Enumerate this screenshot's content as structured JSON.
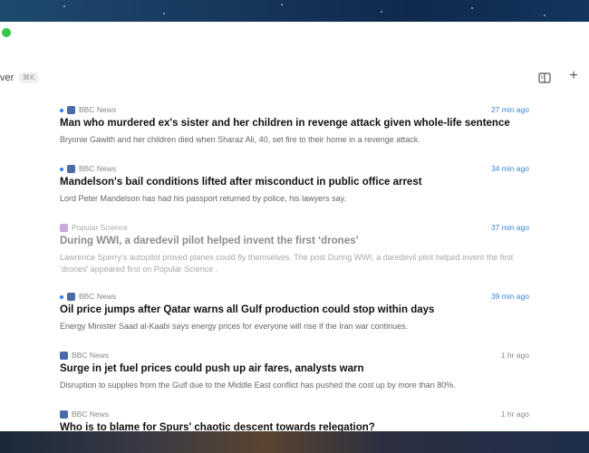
{
  "toolbar": {
    "search_label": "ver",
    "shortcut": "⌘K",
    "columns_icon": "columns-icon",
    "add_label": "+"
  },
  "articles": [
    {
      "source": "BBC News",
      "time": "27 min ago",
      "headline": "Man who murdered ex's sister and her children in revenge attack given whole-life sentence",
      "summary": "Bryonie Gawith and her children died when Sharaz Ali, 40, set fire to their home in a revenge attack.",
      "unread": true
    },
    {
      "source": "BBC News",
      "time": "34 min ago",
      "headline": "Mandelson's bail conditions lifted after misconduct in public office arrest",
      "summary": "Lord Peter Mandelson has had his passport returned by police, his lawyers say.",
      "unread": true
    },
    {
      "source": "Popular Science",
      "time": "37 min ago",
      "headline": "During WWI, a daredevil pilot helped invent the first ‘drones’",
      "summary": "Lawrence Sperry's autopilot proved planes could fly themselves. The post During WWI, a daredevil pilot helped invent the first ‘drones’ appeared first on Popular Science .",
      "unread": false
    },
    {
      "source": "BBC News",
      "time": "39 min ago",
      "headline": "Oil price jumps after Qatar warns all Gulf production could stop within days",
      "summary": "Energy Minister Saad al-Kaabi says energy prices for everyone will rise if the Iran war continues.",
      "unread": true
    },
    {
      "source": "BBC News",
      "time": "1 hr ago",
      "headline": "Surge in jet fuel prices could push up air fares, analysts warn",
      "summary": "Disruption to supplies from the Gulf due to the Middle East conflict has pushed the cost up by more than 80%.",
      "unread": false
    },
    {
      "source": "BBC News",
      "time": "1 hr ago",
      "headline": "Who is to blame for Spurs' chaotic descent towards relegation?",
      "summary": "",
      "unread": false
    }
  ],
  "colors": {
    "unread_dot": "#2f7cf6",
    "recent_time": "#3a86d9",
    "bbc_favicon": "#4a6aa8",
    "popsci_favicon": "#c9a9dc",
    "traffic_green": "#35c749"
  }
}
